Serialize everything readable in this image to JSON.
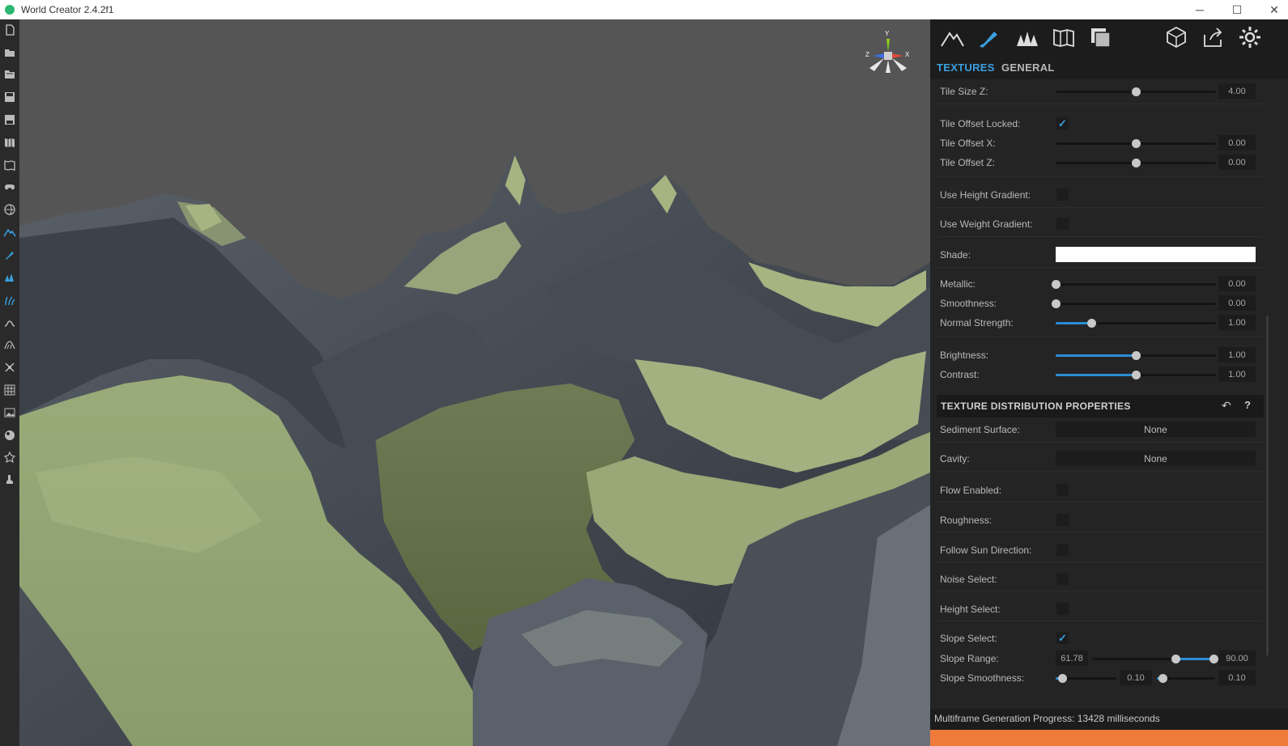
{
  "window": {
    "title": "World Creator 2.4.2f1",
    "min": "─",
    "max": "☐",
    "close": "✕"
  },
  "colors": {
    "accent": "#3aa0e0",
    "progress": "#f07a3a",
    "terrain_light": "#a9b987",
    "terrain_dark": "#3a4048",
    "sky": "#555555"
  },
  "left_toolbar": [
    {
      "name": "new-file-icon"
    },
    {
      "name": "open-folder-icon"
    },
    {
      "name": "open-recent-icon"
    },
    {
      "name": "save-icon"
    },
    {
      "name": "save-as-icon"
    },
    {
      "name": "import-map-icon"
    },
    {
      "name": "map-icon"
    },
    {
      "name": "gamepad-icon"
    },
    {
      "name": "globe-icon"
    },
    {
      "name": "terrain-icon",
      "active": true
    },
    {
      "name": "texture-brush-icon",
      "active": true
    },
    {
      "name": "forest-icon",
      "active": true
    },
    {
      "name": "grass-icon",
      "active": true
    },
    {
      "name": "path-icon"
    },
    {
      "name": "cliff-icon"
    },
    {
      "name": "transform-icon"
    },
    {
      "name": "grid-icon"
    },
    {
      "name": "image-icon"
    },
    {
      "name": "sphere-icon"
    },
    {
      "name": "star-icon"
    },
    {
      "name": "stamp-icon"
    }
  ],
  "panel_toolbar": [
    {
      "name": "terrain-tab-icon"
    },
    {
      "name": "texturing-tab-icon",
      "active": true
    },
    {
      "name": "vegetation-tab-icon"
    },
    {
      "name": "map-tab-icon"
    },
    {
      "name": "layers-tab-icon"
    },
    {
      "name": "3d-box-icon"
    },
    {
      "name": "export-icon"
    },
    {
      "name": "settings-gear-icon"
    }
  ],
  "tabs": {
    "textures": "TEXTURES",
    "general": "GENERAL",
    "active": "textures"
  },
  "properties": {
    "tile_size_z": {
      "label": "Tile Size Z:",
      "value": "4.00",
      "fraction": 0.5
    },
    "tile_offset_locked": {
      "label": "Tile Offset Locked:",
      "checked": true
    },
    "tile_offset_x": {
      "label": "Tile Offset X:",
      "value": "0.00",
      "fraction": 0.5
    },
    "tile_offset_z": {
      "label": "Tile Offset Z:",
      "value": "0.00",
      "fraction": 0.5
    },
    "use_height_gradient": {
      "label": "Use Height Gradient:",
      "checked": false
    },
    "use_weight_gradient": {
      "label": "Use Weight Gradient:",
      "checked": false
    },
    "shade": {
      "label": "Shade:",
      "color": "#ffffff"
    },
    "metallic": {
      "label": "Metallic:",
      "value": "0.00",
      "fraction": 0.0
    },
    "smoothness": {
      "label": "Smoothness:",
      "value": "0.00",
      "fraction": 0.0
    },
    "normal_strength": {
      "label": "Normal Strength:",
      "value": "1.00",
      "fraction": 0.22
    },
    "brightness": {
      "label": "Brightness:",
      "value": "1.00",
      "fraction": 0.5
    },
    "contrast": {
      "label": "Contrast:",
      "value": "1.00",
      "fraction": 0.5
    }
  },
  "distribution": {
    "title": "TEXTURE DISTRIBUTION PROPERTIES",
    "back": "↶",
    "help": "?",
    "sediment_surface": {
      "label": "Sediment Surface:",
      "value": "None"
    },
    "cavity": {
      "label": "Cavity:",
      "value": "None"
    },
    "flow_enabled": {
      "label": "Flow Enabled:",
      "checked": false
    },
    "roughness": {
      "label": "Roughness:",
      "checked": false
    },
    "follow_sun_direction": {
      "label": "Follow Sun Direction:",
      "checked": false
    },
    "noise_select": {
      "label": "Noise Select:",
      "checked": false
    },
    "height_select": {
      "label": "Height Select:",
      "checked": false
    },
    "slope_select": {
      "label": "Slope Select:",
      "checked": true
    },
    "slope_range": {
      "label": "Slope Range:",
      "min": "61.78",
      "max": "90.00",
      "lo_fraction": 0.686,
      "hi_fraction": 1.0
    },
    "slope_smoothness": {
      "label": "Slope Smoothness:",
      "value_a": "0.10",
      "value_b": "0.10",
      "fraction_a": 0.1,
      "fraction_b": 0.1
    }
  },
  "check_mark": "✓",
  "status": {
    "text": "Multiframe Generation Progress: 13428 milliseconds",
    "progress": 1.0
  },
  "gizmo": {
    "y": "Y",
    "x": "X",
    "z": "Z"
  }
}
